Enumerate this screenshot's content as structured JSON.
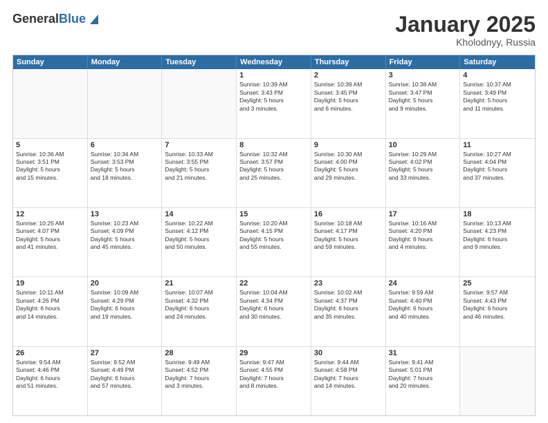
{
  "logo": {
    "general": "General",
    "blue": "Blue"
  },
  "header": {
    "month": "January 2025",
    "location": "Kholodnyy, Russia"
  },
  "weekdays": [
    "Sunday",
    "Monday",
    "Tuesday",
    "Wednesday",
    "Thursday",
    "Friday",
    "Saturday"
  ],
  "rows": [
    [
      {
        "day": "",
        "text": ""
      },
      {
        "day": "",
        "text": ""
      },
      {
        "day": "",
        "text": ""
      },
      {
        "day": "1",
        "text": "Sunrise: 10:39 AM\nSunset: 3:43 PM\nDaylight: 5 hours\nand 3 minutes."
      },
      {
        "day": "2",
        "text": "Sunrise: 10:39 AM\nSunset: 3:45 PM\nDaylight: 5 hours\nand 6 minutes."
      },
      {
        "day": "3",
        "text": "Sunrise: 10:38 AM\nSunset: 3:47 PM\nDaylight: 5 hours\nand 9 minutes."
      },
      {
        "day": "4",
        "text": "Sunrise: 10:37 AM\nSunset: 3:49 PM\nDaylight: 5 hours\nand 11 minutes."
      }
    ],
    [
      {
        "day": "5",
        "text": "Sunrise: 10:36 AM\nSunset: 3:51 PM\nDaylight: 5 hours\nand 15 minutes."
      },
      {
        "day": "6",
        "text": "Sunrise: 10:34 AM\nSunset: 3:53 PM\nDaylight: 5 hours\nand 18 minutes."
      },
      {
        "day": "7",
        "text": "Sunrise: 10:33 AM\nSunset: 3:55 PM\nDaylight: 5 hours\nand 21 minutes."
      },
      {
        "day": "8",
        "text": "Sunrise: 10:32 AM\nSunset: 3:57 PM\nDaylight: 5 hours\nand 25 minutes."
      },
      {
        "day": "9",
        "text": "Sunrise: 10:30 AM\nSunset: 4:00 PM\nDaylight: 5 hours\nand 29 minutes."
      },
      {
        "day": "10",
        "text": "Sunrise: 10:29 AM\nSunset: 4:02 PM\nDaylight: 5 hours\nand 33 minutes."
      },
      {
        "day": "11",
        "text": "Sunrise: 10:27 AM\nSunset: 4:04 PM\nDaylight: 5 hours\nand 37 minutes."
      }
    ],
    [
      {
        "day": "12",
        "text": "Sunrise: 10:25 AM\nSunset: 4:07 PM\nDaylight: 5 hours\nand 41 minutes."
      },
      {
        "day": "13",
        "text": "Sunrise: 10:23 AM\nSunset: 4:09 PM\nDaylight: 5 hours\nand 45 minutes."
      },
      {
        "day": "14",
        "text": "Sunrise: 10:22 AM\nSunset: 4:12 PM\nDaylight: 5 hours\nand 50 minutes."
      },
      {
        "day": "15",
        "text": "Sunrise: 10:20 AM\nSunset: 4:15 PM\nDaylight: 5 hours\nand 55 minutes."
      },
      {
        "day": "16",
        "text": "Sunrise: 10:18 AM\nSunset: 4:17 PM\nDaylight: 5 hours\nand 59 minutes."
      },
      {
        "day": "17",
        "text": "Sunrise: 10:16 AM\nSunset: 4:20 PM\nDaylight: 6 hours\nand 4 minutes."
      },
      {
        "day": "18",
        "text": "Sunrise: 10:13 AM\nSunset: 4:23 PM\nDaylight: 6 hours\nand 9 minutes."
      }
    ],
    [
      {
        "day": "19",
        "text": "Sunrise: 10:11 AM\nSunset: 4:26 PM\nDaylight: 6 hours\nand 14 minutes."
      },
      {
        "day": "20",
        "text": "Sunrise: 10:09 AM\nSunset: 4:29 PM\nDaylight: 6 hours\nand 19 minutes."
      },
      {
        "day": "21",
        "text": "Sunrise: 10:07 AM\nSunset: 4:32 PM\nDaylight: 6 hours\nand 24 minutes."
      },
      {
        "day": "22",
        "text": "Sunrise: 10:04 AM\nSunset: 4:34 PM\nDaylight: 6 hours\nand 30 minutes."
      },
      {
        "day": "23",
        "text": "Sunrise: 10:02 AM\nSunset: 4:37 PM\nDaylight: 6 hours\nand 35 minutes."
      },
      {
        "day": "24",
        "text": "Sunrise: 9:59 AM\nSunset: 4:40 PM\nDaylight: 6 hours\nand 40 minutes."
      },
      {
        "day": "25",
        "text": "Sunrise: 9:57 AM\nSunset: 4:43 PM\nDaylight: 6 hours\nand 46 minutes."
      }
    ],
    [
      {
        "day": "26",
        "text": "Sunrise: 9:54 AM\nSunset: 4:46 PM\nDaylight: 6 hours\nand 51 minutes."
      },
      {
        "day": "27",
        "text": "Sunrise: 9:52 AM\nSunset: 4:49 PM\nDaylight: 6 hours\nand 57 minutes."
      },
      {
        "day": "28",
        "text": "Sunrise: 9:49 AM\nSunset: 4:52 PM\nDaylight: 7 hours\nand 3 minutes."
      },
      {
        "day": "29",
        "text": "Sunrise: 9:47 AM\nSunset: 4:55 PM\nDaylight: 7 hours\nand 8 minutes."
      },
      {
        "day": "30",
        "text": "Sunrise: 9:44 AM\nSunset: 4:58 PM\nDaylight: 7 hours\nand 14 minutes."
      },
      {
        "day": "31",
        "text": "Sunrise: 9:41 AM\nSunset: 5:01 PM\nDaylight: 7 hours\nand 20 minutes."
      },
      {
        "day": "",
        "text": ""
      }
    ]
  ]
}
